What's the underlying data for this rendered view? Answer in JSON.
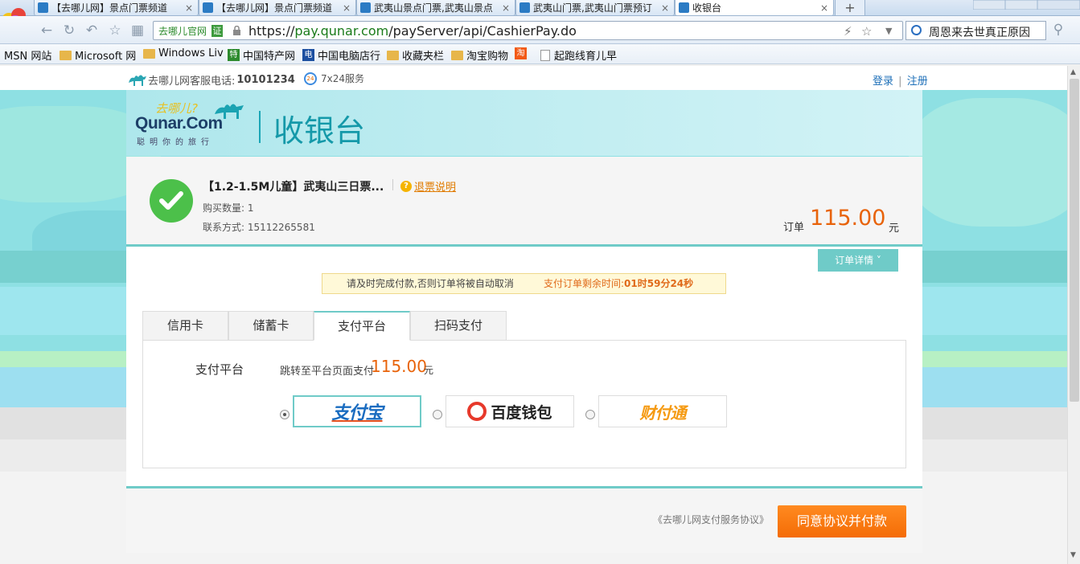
{
  "browser": {
    "tabs": [
      {
        "title": "【去哪儿网】景点门票频道"
      },
      {
        "title": "【去哪儿网】景点门票频道"
      },
      {
        "title": "武夷山景点门票,武夷山景点"
      },
      {
        "title": "武夷山门票,武夷山门票预订"
      },
      {
        "title": "收银台"
      }
    ],
    "tab_close": "×",
    "new_tab": "+",
    "site_badge": "去哪儿官网",
    "cert_badge": "证",
    "url_scheme": "https://",
    "url_host": "pay.qunar.com",
    "url_path": "/payServer/api/CashierPay.do",
    "search_text": "周恩来去世真正原因",
    "bookmarks": [
      {
        "label": "MSN 网站",
        "icon": "none"
      },
      {
        "label": "Microsoft 网",
        "icon": "folder"
      },
      {
        "label": "Windows Liv",
        "icon": "folder"
      },
      {
        "label": "中国特产网",
        "icon": "site"
      },
      {
        "label": "中国电脑店行",
        "icon": "site"
      },
      {
        "label": "收藏夹栏",
        "icon": "folder"
      },
      {
        "label": "淘宝购物",
        "icon": "folder"
      },
      {
        "label": "起跑线育儿早",
        "icon": "page"
      }
    ]
  },
  "topbar": {
    "hotline_label": "去哪儿网客服电话:",
    "hotline_number": "10101234",
    "service": "7x24服务",
    "login": "登录",
    "sep": "|",
    "register": "注册"
  },
  "brand": {
    "fun": "去哪儿?",
    "name": "Qunar.Com",
    "slogan": "聪明你的旅行",
    "page_title": "收银台"
  },
  "order": {
    "product": "【1.2-1.5M儿童】武夷山三日票...",
    "refund_link": "退票说明",
    "quantity": "购买数量: 1",
    "contact": "联系方式: 15112265581",
    "amount_label": "订单",
    "amount": "115.00",
    "currency": "元",
    "details_button": "订单详情 ˅"
  },
  "notice": {
    "message": "请及时完成付款,否则订单将被自动取消",
    "remaining_label": "支付订单剩余时间:",
    "remaining_time": "01时59分24秒"
  },
  "payment": {
    "tabs": [
      "信用卡",
      "储蓄卡",
      "支付平台",
      "扫码支付"
    ],
    "active_tab": "支付平台",
    "platform_label": "支付平台",
    "jump_text": "跳转至平台页面支付",
    "jump_amount": "115.00",
    "jump_currency": "元",
    "options": [
      {
        "name": "支付宝",
        "selected": true
      },
      {
        "name": "百度钱包",
        "selected": false
      },
      {
        "name": "财付通",
        "selected": false
      }
    ]
  },
  "footer": {
    "agreement": "《去哪儿网支付服务协议》",
    "pay_button": "同意协议并付款"
  },
  "colors": {
    "accent": "#6fcbc8",
    "price": "#e8630a",
    "pay_button": "#f46c06",
    "banner": "#8ee0e3",
    "success": "#4cc04a"
  }
}
